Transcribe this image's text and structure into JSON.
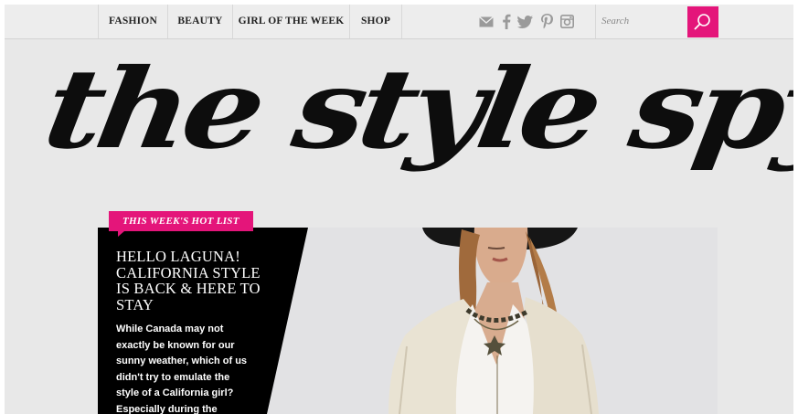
{
  "nav": {
    "items": [
      {
        "label": "FASHION"
      },
      {
        "label": "BEAUTY"
      },
      {
        "label": "GIRL OF THE WEEK"
      },
      {
        "label": "SHOP"
      }
    ],
    "social_icons": [
      "mail-icon",
      "facebook-icon",
      "twitter-icon",
      "pinterest-icon",
      "instagram-icon"
    ],
    "search": {
      "placeholder": "Search",
      "button_icon": "search-icon"
    }
  },
  "logo": {
    "text": "the style spy"
  },
  "hero": {
    "tag": "THIS WEEK'S HOT LIST",
    "headline": "HELLO LAGUNA! CALIFORNIA STYLE IS BACK & HERE TO STAY",
    "excerpt": "While Canada may not exactly be known for our sunny weather, which of us didn't try to emulate the style of a California girl? Especially during the"
  },
  "colors": {
    "accent": "#e4157a",
    "panel": "#000000",
    "background": "#e8e8e8"
  }
}
